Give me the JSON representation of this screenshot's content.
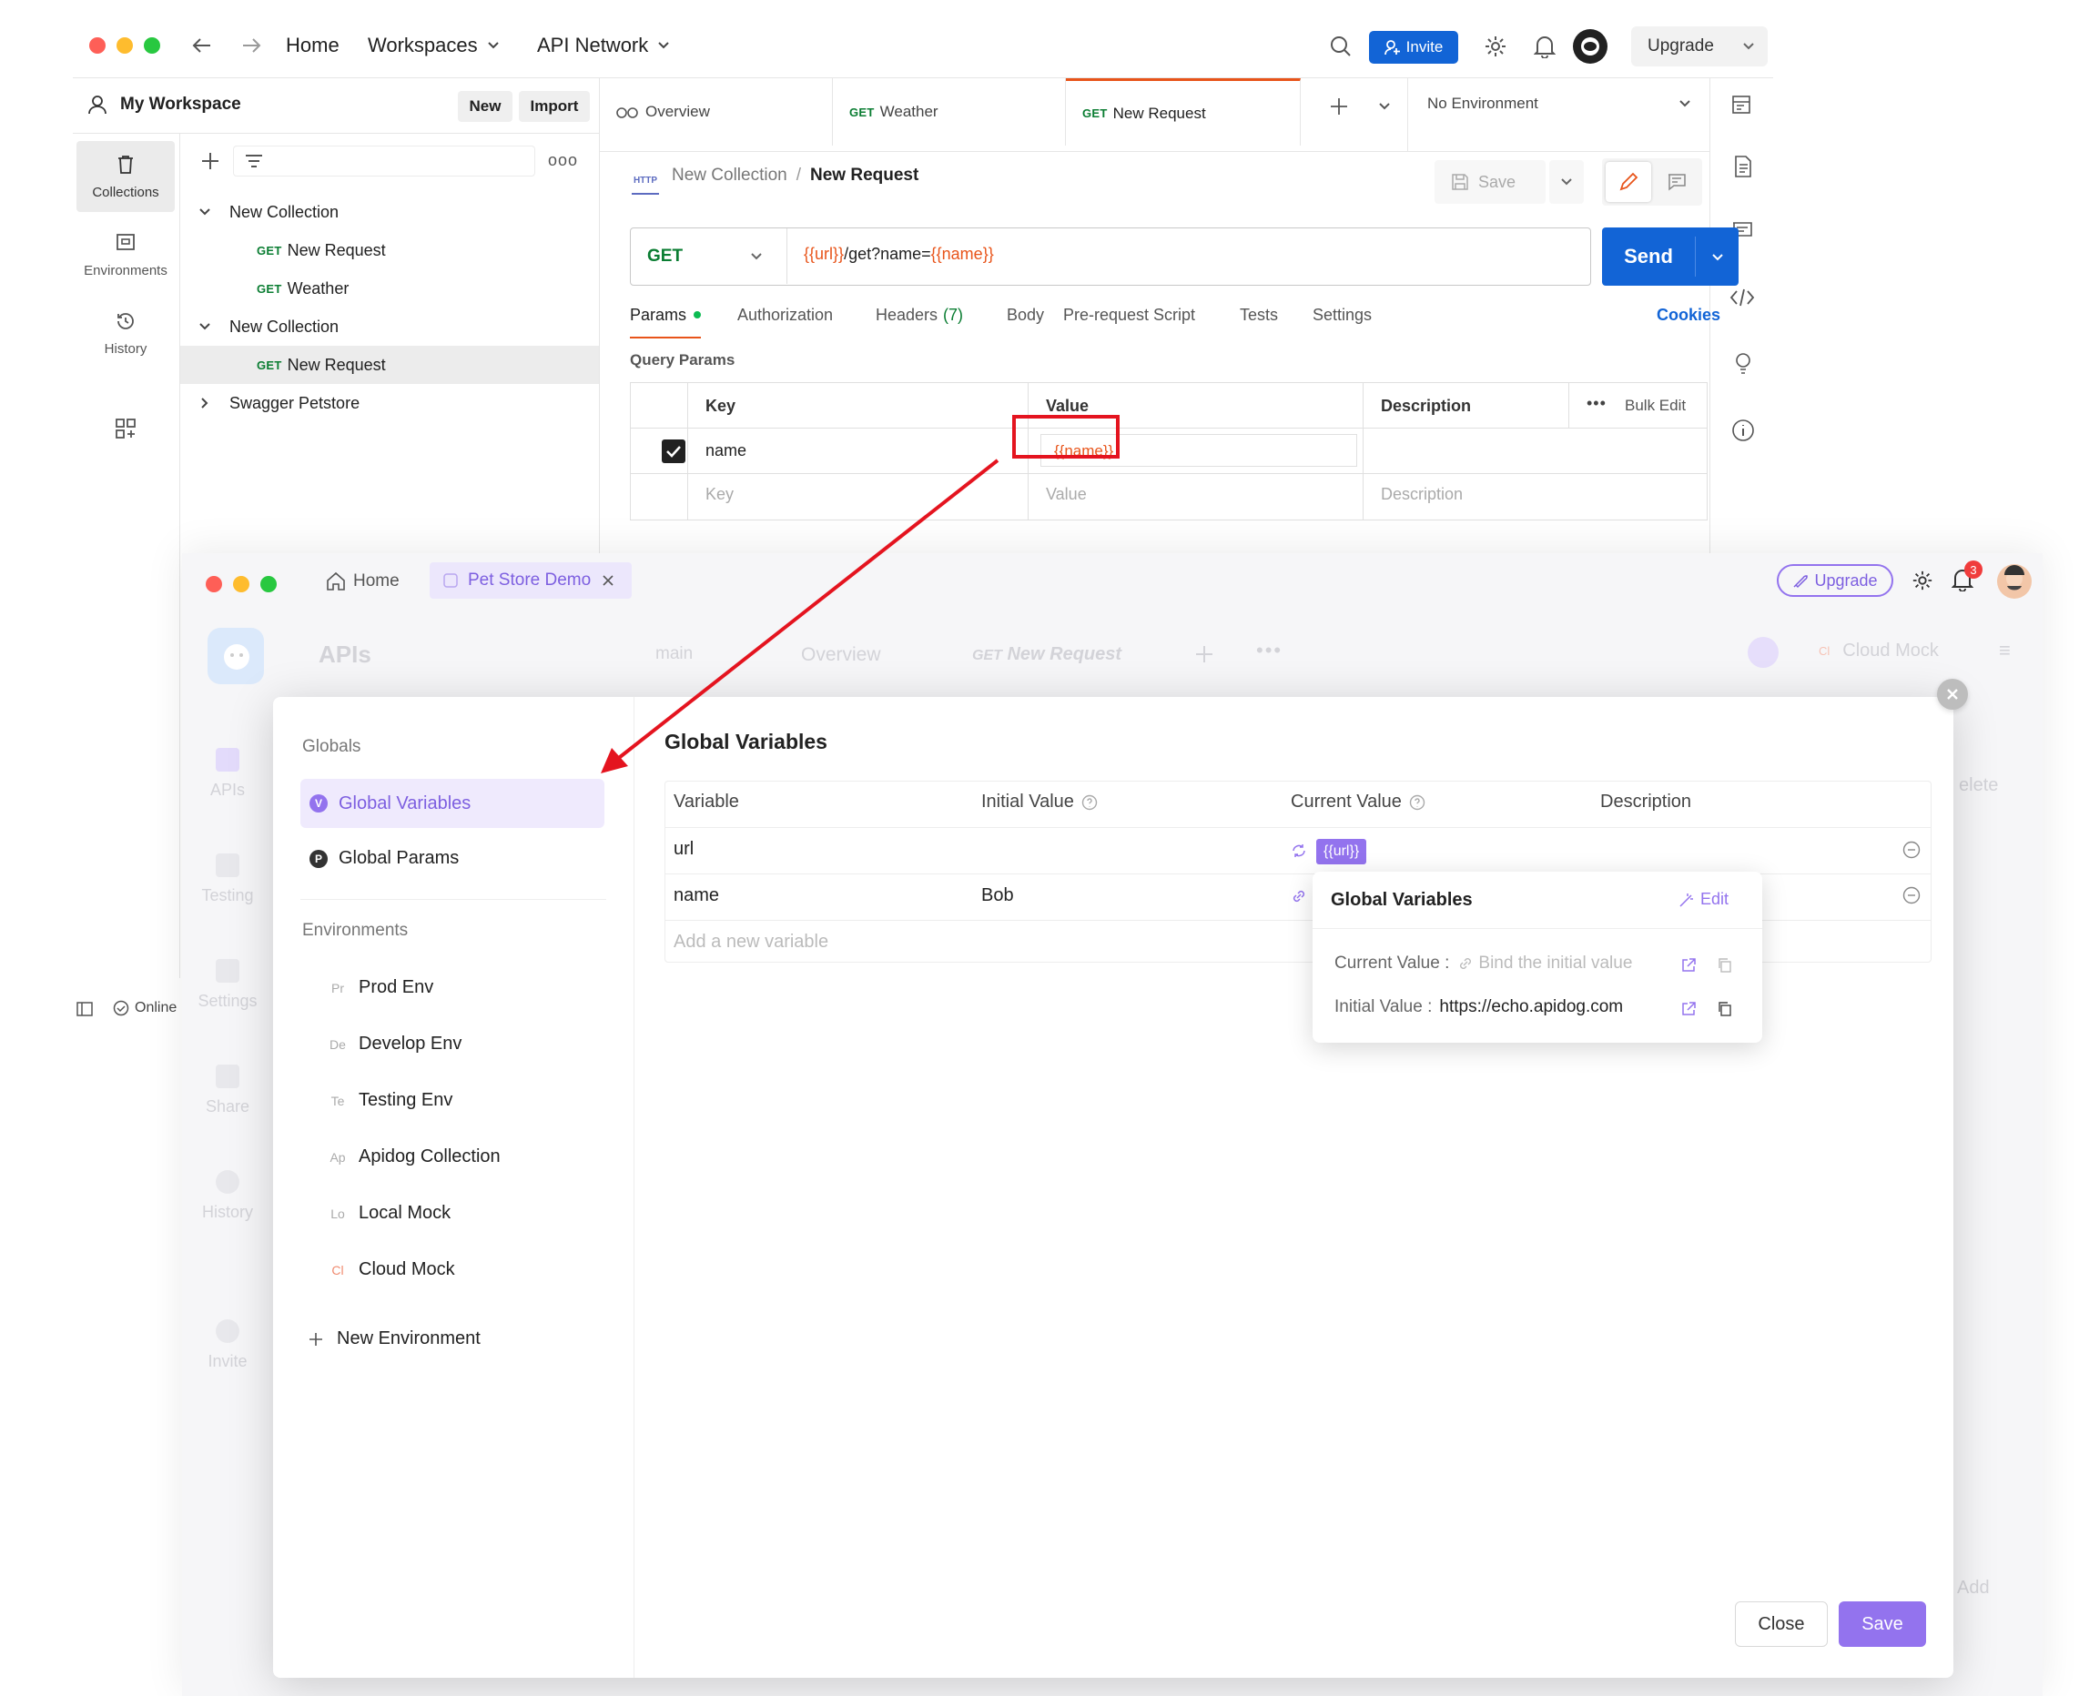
{
  "top": {
    "nav": {
      "home": "Home",
      "workspaces": "Workspaces",
      "api_network": "API Network"
    },
    "invite": "Invite",
    "upgrade": "Upgrade",
    "workspace": {
      "title": "My Workspace",
      "new": "New",
      "import": "Import"
    },
    "side_nav": [
      "Collections",
      "Environments",
      "History"
    ],
    "tree": [
      {
        "label": "New Collection",
        "type": "folder"
      },
      {
        "label": "New Request",
        "type": "request",
        "method": "GET"
      },
      {
        "label": "Weather",
        "type": "request",
        "method": "GET"
      },
      {
        "label": "New Collection",
        "type": "folder"
      },
      {
        "label": "New Request",
        "type": "request",
        "method": "GET"
      },
      {
        "label": "Swagger Petstore",
        "type": "folder"
      }
    ],
    "tabs": [
      {
        "label": "Overview"
      },
      {
        "label": "Weather",
        "method": "GET"
      },
      {
        "label": "New Request",
        "method": "GET"
      }
    ],
    "environment": "No Environment",
    "breadcrumb": {
      "collection": "New Collection",
      "sep": "/",
      "request": "New Request",
      "badge": "HTTP"
    },
    "save": "Save",
    "request": {
      "method": "GET",
      "url_var1": "{{url}}",
      "url_mid": "/get?name=",
      "url_var2": "{{name}}",
      "send": "Send"
    },
    "req_tabs": [
      "Params",
      "Authorization",
      "Headers",
      "(7)",
      "Body",
      "Pre-request Script",
      "Tests",
      "Settings"
    ],
    "cookies": "Cookies",
    "query_params": "Query Params",
    "table": {
      "headers": [
        "Key",
        "Value",
        "Description"
      ],
      "bulk_edit": "Bulk Edit",
      "row": {
        "key": "name",
        "value": "{{name}}"
      },
      "placeholders": {
        "key": "Key",
        "value": "Value",
        "description": "Description"
      }
    },
    "status": "Online"
  },
  "bottom": {
    "nav": {
      "home": "Home",
      "project": "Pet Store Demo"
    },
    "upgrade": "Upgrade",
    "notifications": "3",
    "apis_title": "APIs",
    "branch": "main",
    "overview": "Overview",
    "tab_method": "GET",
    "tab_name": "New Request",
    "cloud_mock": "Cloud Mock",
    "cloud_badge": "Cl",
    "side_nav": [
      "APIs",
      "Testing",
      "Settings",
      "Share",
      "History",
      "Invite"
    ],
    "bg_delete": "elete",
    "bg_add": "Add",
    "modal": {
      "globals_label": "Globals",
      "global_variables": "Global Variables",
      "global_params": "Global Params",
      "gv_badge": "V",
      "gp_badge": "P",
      "environments_label": "Environments",
      "environments": [
        {
          "badge": "Pr",
          "name": "Prod Env"
        },
        {
          "badge": "De",
          "name": "Develop Env"
        },
        {
          "badge": "Te",
          "name": "Testing Env"
        },
        {
          "badge": "Ap",
          "name": "Apidog Collection"
        },
        {
          "badge": "Lo",
          "name": "Local Mock"
        },
        {
          "badge": "Cl",
          "name": "Cloud Mock"
        }
      ],
      "new_environment": "New Environment",
      "title": "Global Variables",
      "headers": [
        "Variable",
        "Initial Value",
        "Current Value",
        "Description"
      ],
      "rows": [
        {
          "variable": "url",
          "initial": "",
          "current": "{{url}}"
        },
        {
          "variable": "name",
          "initial": "Bob",
          "current": ""
        }
      ],
      "add_placeholder": "Add a new variable",
      "popover": {
        "title": "Global Variables",
        "edit": "Edit",
        "current_label": "Current Value :",
        "current_placeholder": "Bind the initial value",
        "initial_label": "Initial Value :",
        "initial_value": "https://echo.apidog.com"
      },
      "close": "Close",
      "save": "Save"
    }
  },
  "colors": {
    "accent_blue": "#1264d6",
    "accent_orange": "#e8541a",
    "apidog_purple": "#9373ee",
    "highlight_red": "#e4141f"
  }
}
